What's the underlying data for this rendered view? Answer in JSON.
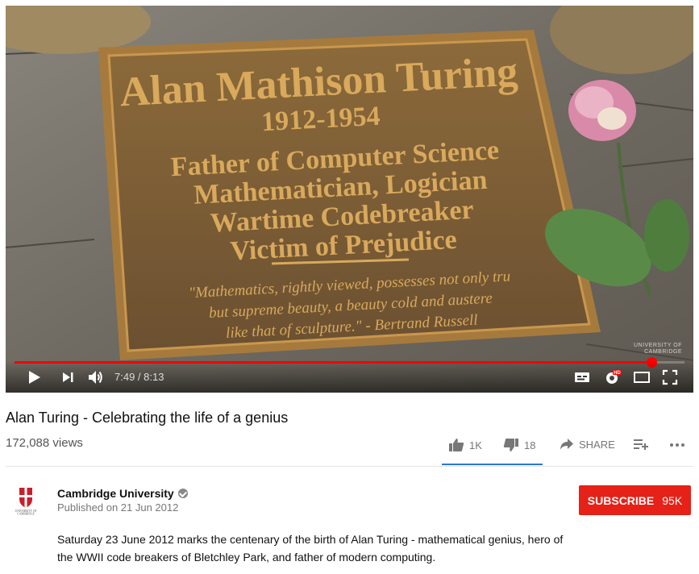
{
  "video": {
    "plaque": {
      "name": "Alan Mathison Turing",
      "years": "1912-1954",
      "lines": [
        "Father of Computer Science",
        "Mathematician, Logician",
        "Wartime Codebreaker",
        "Victim of Prejudice"
      ],
      "quote_lines": [
        "\"Mathematics, rightly viewed, possesses not only tru",
        "but supreme beauty, a beauty cold and austere",
        "like that of sculpture.\"  -  Bertrand Russell"
      ]
    },
    "watermark": "UNIVERSITY OF\nCAMBRIDGE",
    "current_time": "7:49",
    "duration": "8:13",
    "time_separator": " / ",
    "progress_fraction": 0.951,
    "hd_badge": "HD",
    "icons": [
      "play-icon",
      "next-icon",
      "volume-icon",
      "captions-icon",
      "settings-icon",
      "theater-icon",
      "fullscreen-icon"
    ]
  },
  "title": "Alan Turing - Celebrating the life of a genius",
  "views": "172,088 views",
  "actions": {
    "like_count": "1K",
    "dislike_count": "18",
    "share_label": "SHARE"
  },
  "channel": {
    "name": "Cambridge University",
    "published": "Published on 21 Jun 2012",
    "crest_text": "UNIVERSITY OF CAMBRIDGE"
  },
  "subscribe": {
    "label": "SUBSCRIBE",
    "count": "95K"
  },
  "colors": {
    "accent_red": "#e62117",
    "progress_red": "#ff0000",
    "like_blue": "#2a78d8"
  },
  "description": "Saturday 23 June 2012 marks the centenary of the birth of Alan Turing - mathematical genius, hero of the WWII code breakers of Bletchley Park, and father of modern computing."
}
